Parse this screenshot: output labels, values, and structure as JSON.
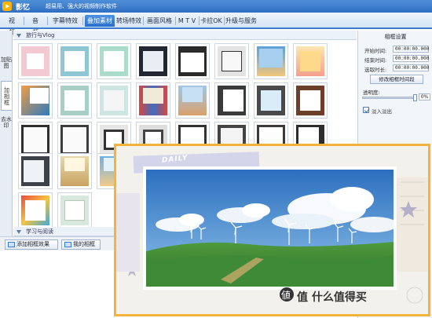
{
  "window": {
    "app_name": "影忆",
    "slogan": "超易用、强大的视频制作软件"
  },
  "menu": {
    "items": [
      "视　频",
      "音　频",
      "字幕特效",
      "叠加素材",
      "转场特效",
      "画面风格",
      "M T V",
      "卡拉OK",
      "升级与服务"
    ],
    "active": "叠加素材"
  },
  "left_tabs": [
    "加贴图",
    "加相框",
    "去水印"
  ],
  "left_tabs_active": "加相框",
  "gallery": {
    "section1_title": "旅行与Vlog",
    "section2_title": "学习与阅读"
  },
  "bottom_buttons": {
    "add_frame": "添加相框效果",
    "my_frames": "我的相框"
  },
  "frame_settings": {
    "title": "相框设置",
    "start_label": "开始时间:",
    "start_value": "00:00:00.000",
    "end_label": "结束时间:",
    "end_value": "00:00:00.000",
    "duration_label": "选取时长:",
    "duration_value": "00:00:00.000",
    "modify_button": "修改相框时间段",
    "opacity_label": "透明度:",
    "opacity_value": "0%",
    "opacity_level": 0.98,
    "fade_label": "淡入淡出",
    "fade_checked": true
  },
  "overlay": {
    "tape_text": "DAILY",
    "caption": "值 什么值得买"
  },
  "colors": {
    "accent_blue": "#2a6fcb",
    "overlay_border": "#f4b43a",
    "sky_top": "#2d6fbf",
    "grass": "#3f8a37"
  }
}
